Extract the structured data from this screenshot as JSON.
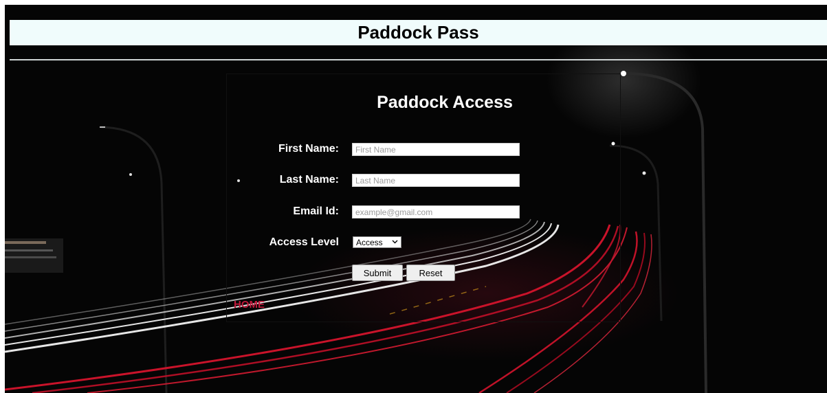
{
  "site": {
    "header_title": "Paddock Pass"
  },
  "form": {
    "title": "Paddock Access",
    "fields": [
      {
        "label": "First Name:",
        "placeholder": "First Name",
        "value": ""
      },
      {
        "label": "Last Name:",
        "placeholder": "Last Name",
        "value": ""
      },
      {
        "label": "Email Id:",
        "placeholder": "example@gmail.com",
        "value": ""
      }
    ],
    "access": {
      "label": "Access Level",
      "selected": "Access"
    },
    "submit_label": "Submit",
    "reset_label": "Reset"
  },
  "nav": {
    "home_label": "HOME"
  },
  "colors": {
    "header_band": "#f0fcfc",
    "background": "#050505",
    "home_link": "#c0183a",
    "light_trail_red": "#d4142c",
    "light_trail_white": "#f2f2f2"
  }
}
